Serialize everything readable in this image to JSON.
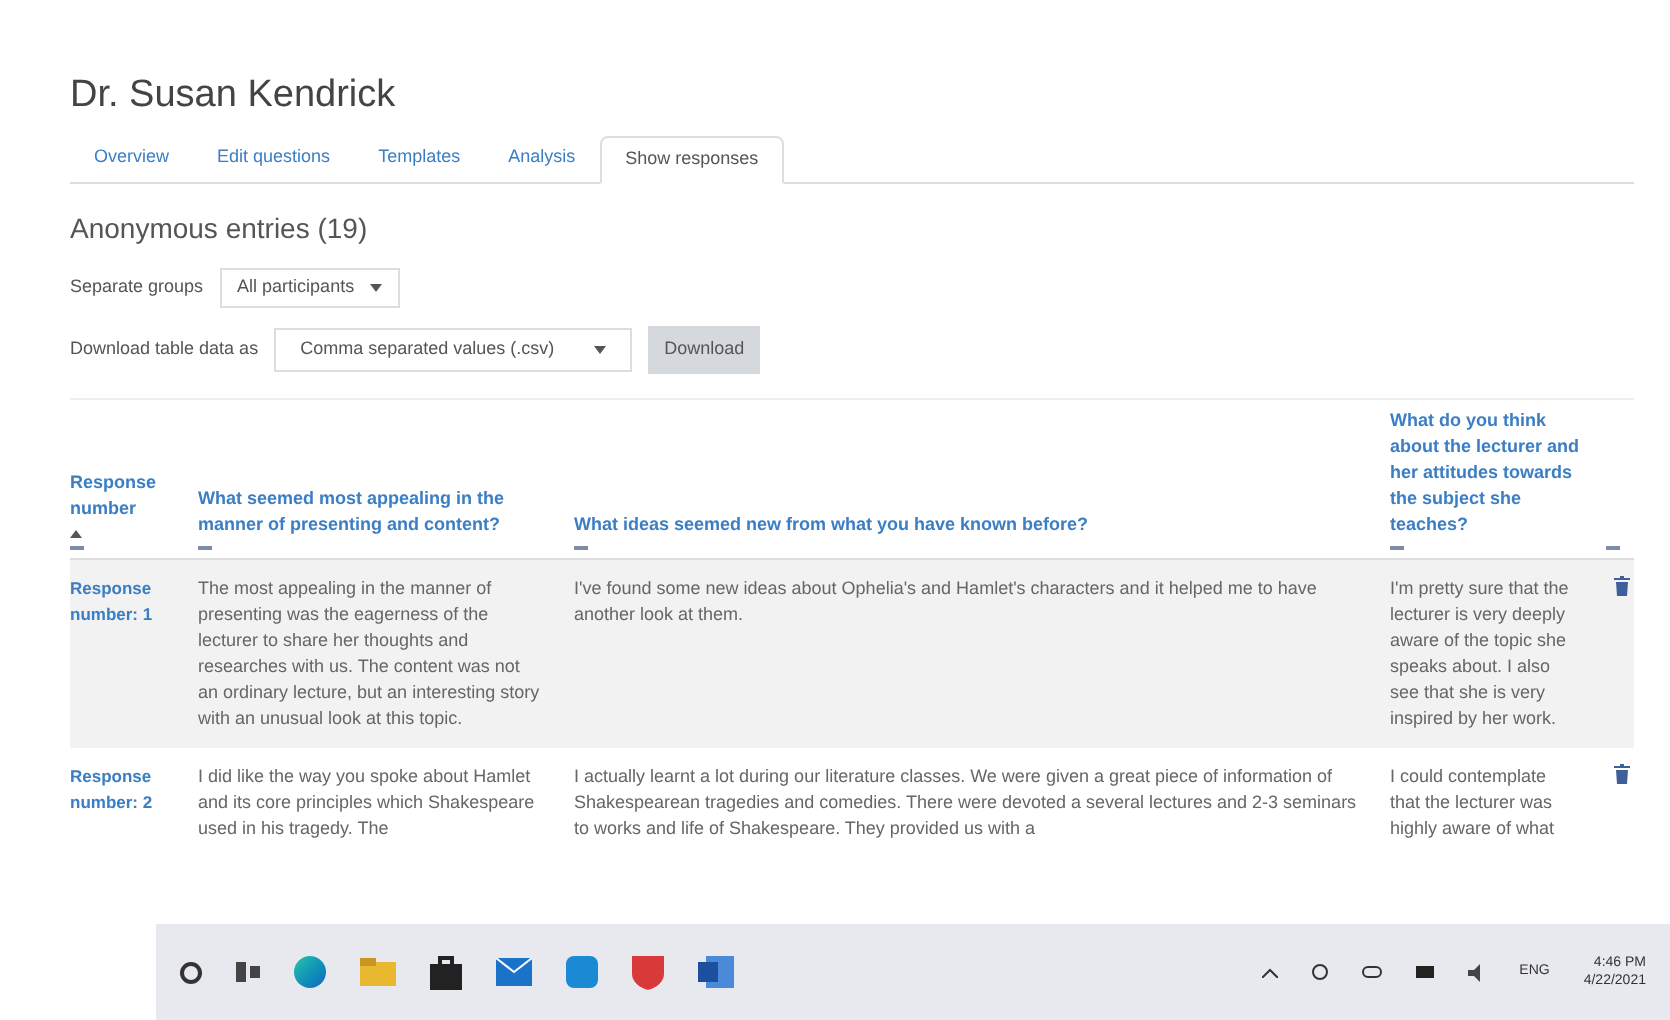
{
  "heading": "Dr. Susan Kendrick",
  "tabs": [
    {
      "label": "Overview",
      "selected": false
    },
    {
      "label": "Edit questions",
      "selected": false
    },
    {
      "label": "Templates",
      "selected": false
    },
    {
      "label": "Analysis",
      "selected": false
    },
    {
      "label": "Show responses",
      "selected": true
    }
  ],
  "entries_title": "Anonymous entries (19)",
  "groups": {
    "label": "Separate groups",
    "value": "All participants"
  },
  "download": {
    "label": "Download table data as",
    "value": "Comma separated values (.csv)",
    "button": "Download"
  },
  "table": {
    "columns": [
      {
        "label": "Response number",
        "sortable": true
      },
      {
        "label": "What seemed most appealing in the manner of presenting and content?",
        "sortable": false
      },
      {
        "label": "What ideas seemed new from what you have known before?",
        "sortable": false
      },
      {
        "label": "What do you think about the lecturer and her attitudes towards the subject she teaches?",
        "sortable": false
      }
    ],
    "rows": [
      {
        "number": "Response number: 1",
        "answers": [
          "The most appealing in the manner of presenting was the eagerness of the lecturer to share her thoughts and researches with us. The content was not an ordinary lecture, but an interesting story with an unusual look at this topic.",
          "I've found some new ideas about Ophelia's and Hamlet's characters and it helped me to have another look at them.",
          "I'm pretty sure that the lecturer is very deeply aware of the topic she speaks about. I also see that she is very inspired by her work."
        ],
        "shaded": true
      },
      {
        "number": "Response number: 2",
        "answers": [
          "I did like the way you spoke about Hamlet and its core principles which Shakespeare used in his tragedy. The",
          "I actually learnt a lot during our literature classes. We were given a great piece of information of Shakespearean tragedies and comedies. There were devoted a several lectures and 2-3 seminars to works and life of Shakespeare. They provided us with a",
          "I could contemplate that the lecturer was highly aware of what"
        ],
        "shaded": false
      }
    ]
  },
  "taskbar": {
    "language": "ENG",
    "time": "4:46 PM",
    "date": "4/22/2021"
  }
}
